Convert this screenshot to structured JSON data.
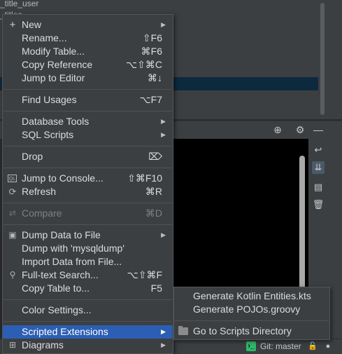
{
  "tree": {
    "rows": [
      "_title_user",
      "",
      "_titles",
      "",
      "",
      "",
      ""
    ]
  },
  "statusbar": {
    "git_branch": "Git: master"
  },
  "menu": {
    "items": [
      {
        "label": "New",
        "icon": "plus-icon",
        "submenu": true
      },
      {
        "label": "Rename...",
        "shortcut": "⇧F6"
      },
      {
        "label": "Modify Table...",
        "shortcut": "⌘F6"
      },
      {
        "label": "Copy Reference",
        "shortcut": "⌥⇧⌘C"
      },
      {
        "label": "Jump to Editor",
        "shortcut": "⌘↓"
      },
      {
        "label": "Find Usages",
        "shortcut": "⌥F7"
      },
      {
        "label": "Database Tools",
        "submenu": true
      },
      {
        "label": "SQL Scripts",
        "submenu": true
      },
      {
        "label": "Drop",
        "shortcut": "⌦"
      },
      {
        "label": "Jump to Console...",
        "shortcut": "⇧⌘F10",
        "icon": "ql-console-icon"
      },
      {
        "label": "Refresh",
        "shortcut": "⌘R",
        "icon": "refresh-icon"
      },
      {
        "label": "Compare",
        "shortcut": "⌘D",
        "icon": "compare-icon",
        "disabled": true
      },
      {
        "label": "Dump Data to File",
        "icon": "save-icon",
        "submenu": true
      },
      {
        "label": "Dump with 'mysqldump'"
      },
      {
        "label": "Import Data from File..."
      },
      {
        "label": "Full-text Search...",
        "shortcut": "⌥⇧⌘F",
        "icon": "search-icon"
      },
      {
        "label": "Copy Table to...",
        "shortcut": "F5"
      },
      {
        "label": "Color Settings..."
      },
      {
        "label": "Scripted Extensions",
        "submenu": true,
        "active": true
      },
      {
        "label": "Diagrams",
        "icon": "diagram-icon",
        "submenu": true
      }
    ]
  },
  "submenu": {
    "items": [
      {
        "label": "Generate Kotlin Entities.kts"
      },
      {
        "label": "Generate POJOs.groovy"
      },
      {
        "label": "Go to Scripts Directory",
        "icon": "folder-icon"
      }
    ]
  },
  "colors": {
    "menu_bg": "#3c3f41",
    "selection": "#2c5fb3",
    "console_bg": "#000000",
    "git_icon": "#2fb86a"
  }
}
